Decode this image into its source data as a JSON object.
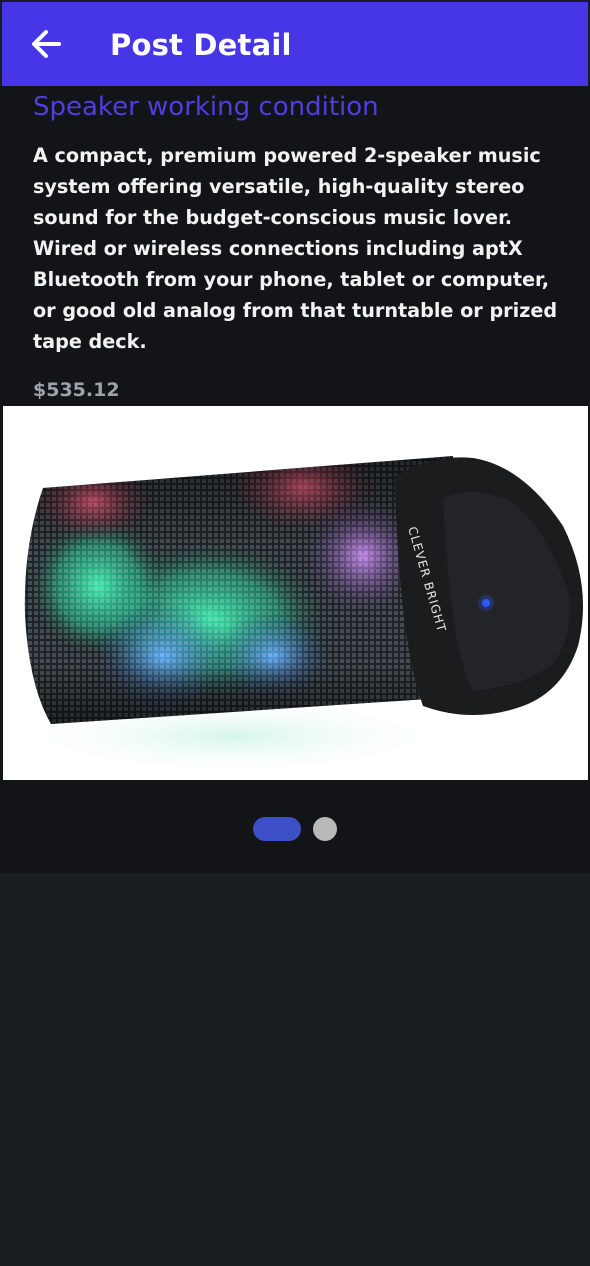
{
  "appbar": {
    "title": "Post Detail",
    "back_icon": "arrow-left-icon",
    "background_color": "#4736e8"
  },
  "post": {
    "title": "Speaker working condition",
    "description": "A compact, premium powered 2-speaker music system offering versatile, high-quality stereo sound for the budget-conscious music lover. Wired or wireless connections including aptX Bluetooth from your phone, tablet or computer, or good old analog from that turntable or prized tape deck.",
    "price": "$535.12",
    "image": {
      "subject": "cylindrical LED bluetooth speaker",
      "brand_text": "CLEVER BRIGHT"
    },
    "title_color": "#4d3fe0"
  },
  "carousel": {
    "page_count": 2,
    "active_index": 0,
    "active_color": "#3c4fc7",
    "inactive_color": "#b9b9b9"
  }
}
